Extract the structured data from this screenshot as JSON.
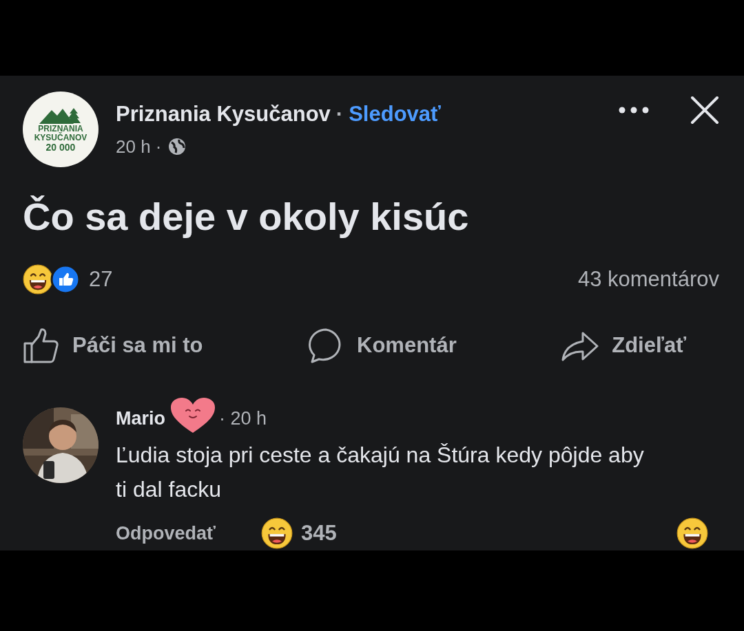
{
  "post": {
    "page_logo": {
      "line_1": "PRIZNANIA",
      "line_2": "KYSUČANOV",
      "line_3": "20 000"
    },
    "author": "Priznania Kysučanov",
    "separator": "·",
    "follow": "Sledovať",
    "time": "20 h ·",
    "text": "Čo sa deje v okoly kisúc",
    "reaction_count": "27",
    "comments_count": "43 komentárov",
    "actions": [
      {
        "kind": "like",
        "label": "Páči sa mi to"
      },
      {
        "kind": "comment",
        "label": "Komentár"
      },
      {
        "kind": "share",
        "label": "Zdieľať"
      }
    ]
  },
  "comment": {
    "author_visible": "Mario",
    "time": "· 20 h",
    "text": "Ľudia stoja pri ceste a čakajú na Štúra kedy pôjde aby ti dal facku",
    "reply": "Odpovedať",
    "reaction_count": "345"
  }
}
